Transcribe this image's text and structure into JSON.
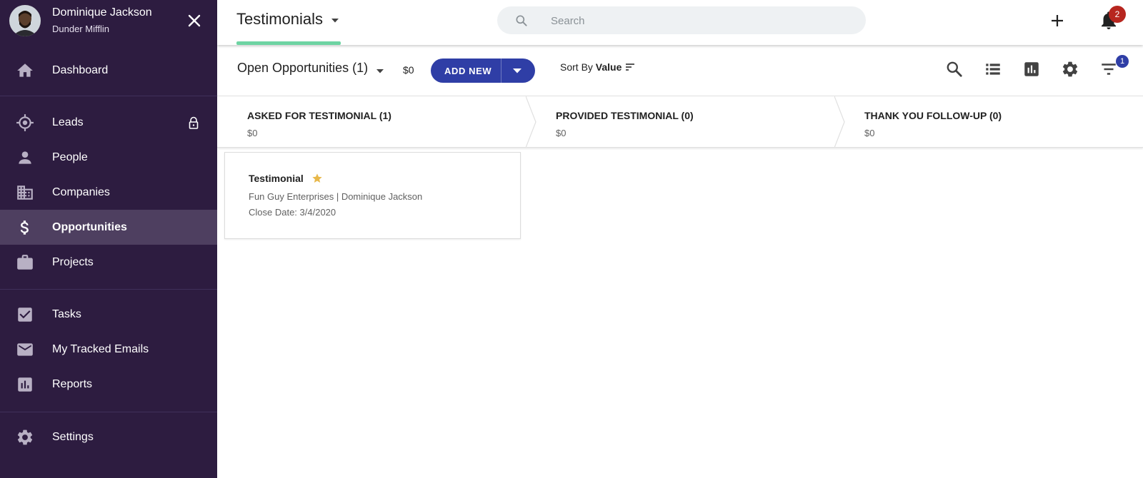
{
  "user": {
    "name": "Dominique Jackson",
    "organization": "Dunder Mifflin"
  },
  "sidebar": {
    "items": [
      {
        "label": "Dashboard",
        "icon": "home-icon"
      },
      {
        "label": "Leads",
        "icon": "target-icon",
        "locked": true
      },
      {
        "label": "People",
        "icon": "person-icon"
      },
      {
        "label": "Companies",
        "icon": "building-icon"
      },
      {
        "label": "Opportunities",
        "icon": "dollar-icon",
        "active": true
      },
      {
        "label": "Projects",
        "icon": "briefcase-icon"
      },
      {
        "label": "Tasks",
        "icon": "checkbox-icon"
      },
      {
        "label": "My Tracked Emails",
        "icon": "mail-icon"
      },
      {
        "label": "Reports",
        "icon": "bar-chart-icon"
      },
      {
        "label": "Settings",
        "icon": "gear-icon"
      }
    ]
  },
  "header": {
    "title": "Testimonials",
    "search_placeholder": "Search",
    "notification_count": "2"
  },
  "toolbar": {
    "pipeline_filter": "Open Opportunities (1)",
    "total_value": "$0",
    "add_new_label": "ADD NEW",
    "sort_prefix": "Sort By",
    "sort_field": "Value",
    "filter_count": "1"
  },
  "stages": [
    {
      "title": "ASKED FOR TESTIMONIAL (1)",
      "value": "$0"
    },
    {
      "title": "PROVIDED TESTIMONIAL (0)",
      "value": "$0"
    },
    {
      "title": "THANK YOU FOLLOW-UP (0)",
      "value": "$0"
    }
  ],
  "cards": [
    {
      "title": "Testimonial",
      "starred": true,
      "subtitle": "Fun Guy Enterprises | Dominique Jackson",
      "close_date": "Close Date: 3/4/2020"
    }
  ],
  "colors": {
    "sidebar_bg": "#2d1c40",
    "sidebar_active": "#4e3f60",
    "primary": "#2f3ea6",
    "tab_underline": "#6ed4a3",
    "badge_red": "#b7261f",
    "star": "#e8b84a"
  }
}
